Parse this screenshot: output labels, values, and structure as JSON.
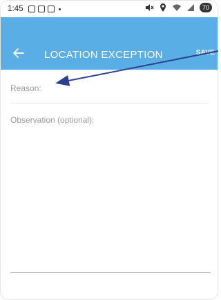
{
  "status_bar": {
    "time": "1:45",
    "battery": "70",
    "left_icons": [
      "calendar-icon",
      "screenshot-icon",
      "calendar-31-icon",
      "dot-icon"
    ],
    "right_icons": [
      "mute-icon",
      "location-icon",
      "wifi-icon",
      "signal-icon",
      "battery-icon"
    ]
  },
  "app_bar": {
    "title": "LOCATION EXCEPTION",
    "save_label": "SAVE",
    "back_icon": "arrow-left-icon",
    "background": "#5aaee6",
    "text_color": "#ffffff"
  },
  "form": {
    "reason_placeholder": "Reason:",
    "observation_placeholder": "Observation (optional):"
  },
  "annotation": {
    "arrow_color": "#2d3f8f"
  }
}
